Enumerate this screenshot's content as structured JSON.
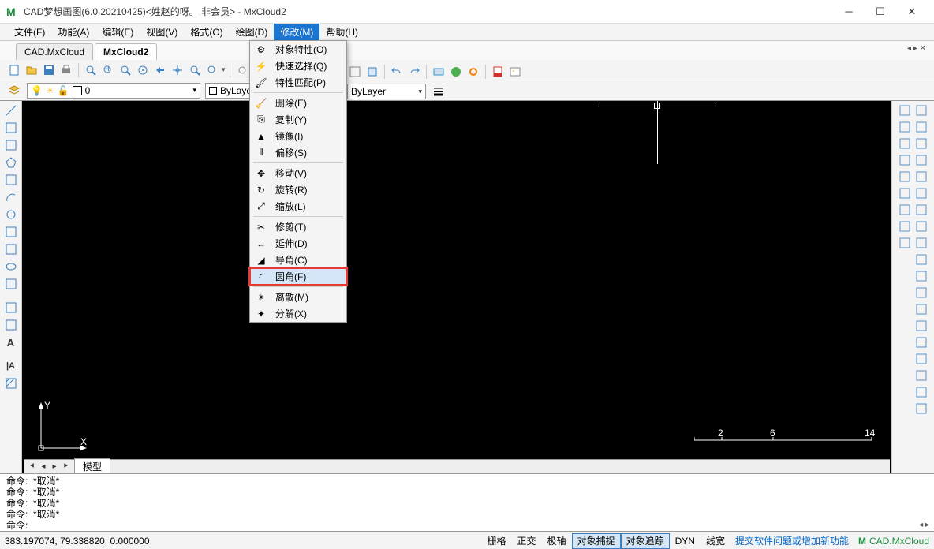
{
  "title": "CAD梦想画图(6.0.20210425)<姓赵的呀。,非会员> - MxCloud2",
  "menubar": [
    "文件(F)",
    "功能(A)",
    "编辑(E)",
    "视图(V)",
    "格式(O)",
    "绘图(D)",
    "修改(M)",
    "帮助(H)"
  ],
  "active_menu_index": 6,
  "doc_tabs": {
    "items": [
      "CAD.MxCloud",
      "MxCloud2"
    ],
    "active": 1
  },
  "layer": {
    "name": "0"
  },
  "combo1": "ByLayer",
  "combo2": "ByLayer",
  "dropdown": [
    {
      "icon": "props",
      "label": "对象特性(O)"
    },
    {
      "icon": "qselect",
      "label": "快速选择(Q)"
    },
    {
      "icon": "match",
      "label": "特性匹配(P)"
    },
    {
      "sep": true
    },
    {
      "icon": "erase",
      "label": "删除(E)"
    },
    {
      "icon": "copy",
      "label": "复制(Y)"
    },
    {
      "icon": "mirror",
      "label": "镜像(I)"
    },
    {
      "icon": "offset",
      "label": "偏移(S)"
    },
    {
      "sep": true
    },
    {
      "icon": "move",
      "label": "移动(V)"
    },
    {
      "icon": "rotate",
      "label": "旋转(R)"
    },
    {
      "icon": "scale",
      "label": "缩放(L)"
    },
    {
      "sep": true
    },
    {
      "icon": "trim",
      "label": "修剪(T)"
    },
    {
      "icon": "extend",
      "label": "延伸(D)"
    },
    {
      "icon": "chamfer",
      "label": "导角(C)"
    },
    {
      "icon": "fillet",
      "label": "圆角(F)",
      "highlight": true
    },
    {
      "sep": true
    },
    {
      "icon": "break",
      "label": "离散(M)"
    },
    {
      "icon": "explode",
      "label": "分解(X)"
    }
  ],
  "model_tab": "模型",
  "cmd_lines": [
    "命令:  *取消*",
    "命令:  *取消*",
    "命令:  *取消*",
    "命令:  *取消*",
    "命令:"
  ],
  "status": {
    "coords": "383.197074,  79.338820,  0.000000",
    "buttons": [
      "栅格",
      "正交",
      "极轴",
      "对象捕捉",
      "对象追踪",
      "DYN",
      "线宽"
    ],
    "on_idx": [
      3,
      4
    ],
    "link": "提交软件问题或增加新功能",
    "brand": "CAD.MxCloud"
  },
  "ruler": {
    "marks": [
      "2",
      "6",
      "14"
    ]
  }
}
